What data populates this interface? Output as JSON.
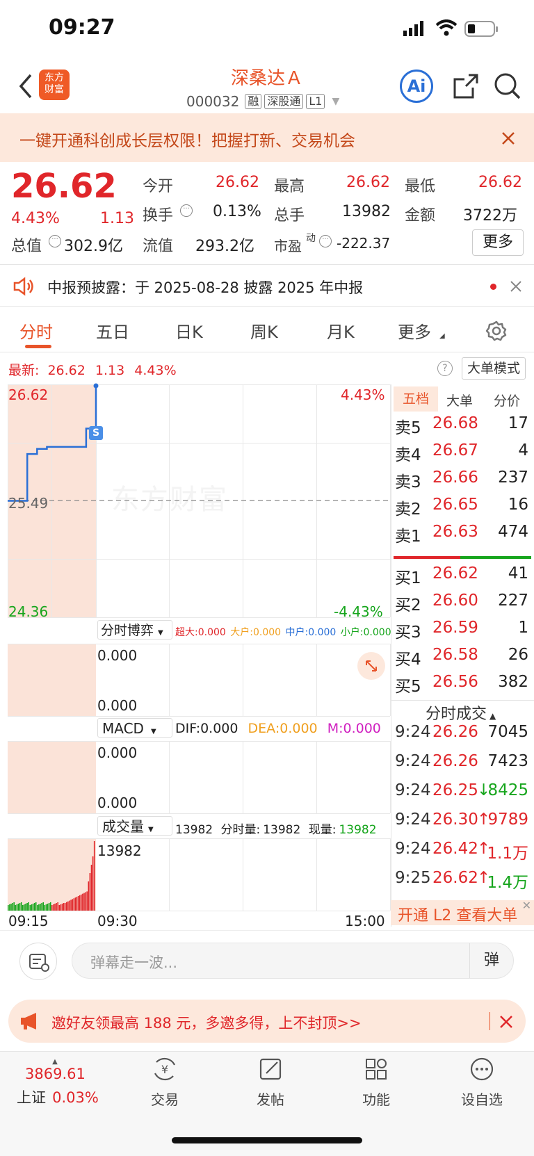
{
  "status_bar": {
    "time": "09:27"
  },
  "header": {
    "title": "深桑达Ａ",
    "code": "000032",
    "tags": [
      "融",
      "深股通",
      "L1"
    ],
    "logo_text": "东方财富",
    "ai_label": "Ai"
  },
  "promo_banner": {
    "text": "一键开通科创成长层权限！把握打新、交易机会"
  },
  "quote": {
    "price": "26.62",
    "change_pct": "4.43%",
    "change_amt": "1.13",
    "open_label": "今开",
    "open": "26.62",
    "high_label": "最高",
    "high": "26.62",
    "low_label": "最低",
    "low": "26.62",
    "turnover_label": "换手",
    "turnover": "0.13%",
    "volume_label": "总手",
    "volume": "13982",
    "amount_label": "金额",
    "amount": "3722万",
    "mktcap_label": "总值",
    "mktcap": "302.9亿",
    "float_label": "流值",
    "float_cap": "293.2亿",
    "pe_label": "市盈",
    "pe_sup": "动",
    "pe": "-222.37",
    "more_label": "更多"
  },
  "notice": {
    "text": "中报预披露：于 2025-08-28 披露 2025 年中报"
  },
  "tabs": [
    "分时",
    "五日",
    "日K",
    "周K",
    "月K",
    "更多"
  ],
  "chart_header": {
    "latest_label": "最新:",
    "price": "26.62",
    "change": "1.13",
    "pct": "4.43%",
    "mode_button": "大单模式"
  },
  "chart": {
    "y_top": "26.62",
    "y_mid": "25.49",
    "y_bottom": "24.36",
    "pct_top": "4.43%",
    "pct_bottom": "-4.43%",
    "watermark": "东方财富",
    "s_marker": "S",
    "x_start": "09:15",
    "x_mid": "09:30",
    "x_end": "15:00"
  },
  "chart_data": {
    "type": "line",
    "title": "",
    "x": [
      "09:15",
      "09:17",
      "09:18",
      "09:19",
      "09:20",
      "09:21",
      "09:22",
      "09:23",
      "09:24",
      "09:25"
    ],
    "series": [
      {
        "values": [
          25.49,
          25.49,
          25.95,
          26.0,
          26.02,
          26.02,
          26.02,
          26.02,
          26.2,
          26.62
        ]
      }
    ],
    "ylim": [
      24.36,
      26.62
    ],
    "reference_price": 25.49
  },
  "bosai": {
    "label": "分时博弈",
    "items": [
      {
        "name": "超大",
        "value": "0.000",
        "color": "#e0262a"
      },
      {
        "name": "大户",
        "value": "0.000",
        "color": "#f0a020"
      },
      {
        "name": "中户",
        "value": "0.000",
        "color": "#2a6fd6"
      },
      {
        "name": "小户",
        "value": "0.000",
        "color": "#16a51c"
      }
    ],
    "top_val": "0.000",
    "bottom_val": "0.000"
  },
  "macd": {
    "label": "MACD",
    "dif_label": "DIF:",
    "dif": "0.000",
    "dea_label": "DEA:",
    "dea": "0.000",
    "m_label": "M:",
    "m": "0.000",
    "top_val": "0.000",
    "bottom_val": "0.000"
  },
  "volume": {
    "label": "成交量",
    "total": "13982",
    "fs_label": "分时量:",
    "fs_val": "13982",
    "cur_label": "现量:",
    "cur_val": "13982",
    "axis_top": "13982"
  },
  "order_book": {
    "tabs": [
      "五档",
      "大单",
      "分价"
    ],
    "asks": [
      {
        "label": "卖5",
        "price": "26.68",
        "vol": "17"
      },
      {
        "label": "卖4",
        "price": "26.67",
        "vol": "4"
      },
      {
        "label": "卖3",
        "price": "26.66",
        "vol": "237"
      },
      {
        "label": "卖2",
        "price": "26.65",
        "vol": "16"
      },
      {
        "label": "卖1",
        "price": "26.63",
        "vol": "474"
      }
    ],
    "bids": [
      {
        "label": "买1",
        "price": "26.62",
        "vol": "41"
      },
      {
        "label": "买2",
        "price": "26.60",
        "vol": "227"
      },
      {
        "label": "买3",
        "price": "26.59",
        "vol": "1"
      },
      {
        "label": "买4",
        "price": "26.58",
        "vol": "26"
      },
      {
        "label": "买5",
        "price": "26.56",
        "vol": "382"
      }
    ]
  },
  "ticks": {
    "header": "分时成交",
    "rows": [
      {
        "time": "9:24",
        "price": "26.26",
        "arrow": "",
        "vol": "7045"
      },
      {
        "time": "9:24",
        "price": "26.26",
        "arrow": "",
        "vol": "7423"
      },
      {
        "time": "9:24",
        "price": "26.25",
        "arrow": "↓",
        "vol": "8425"
      },
      {
        "time": "9:24",
        "price": "26.30",
        "arrow": "↑",
        "vol": "9789"
      },
      {
        "time": "9:24",
        "price": "26.42",
        "arrow": "↑",
        "vol": "1.1万"
      },
      {
        "time": "9:25",
        "price": "26.62",
        "arrow": "↑",
        "vol": "1.4万"
      }
    ],
    "l2_promo": "开通 L2 查看大单"
  },
  "comment": {
    "placeholder": "弹幕走一波...",
    "danmu_label": "弹"
  },
  "invite": {
    "text": "邀好友领最高 188 元，多邀多得，上不封顶>>"
  },
  "bottom_nav": {
    "index_value": "3869.61",
    "index_name": "上证",
    "index_pct": "0.03%",
    "items": [
      "交易",
      "发帖",
      "功能",
      "设自选"
    ]
  }
}
